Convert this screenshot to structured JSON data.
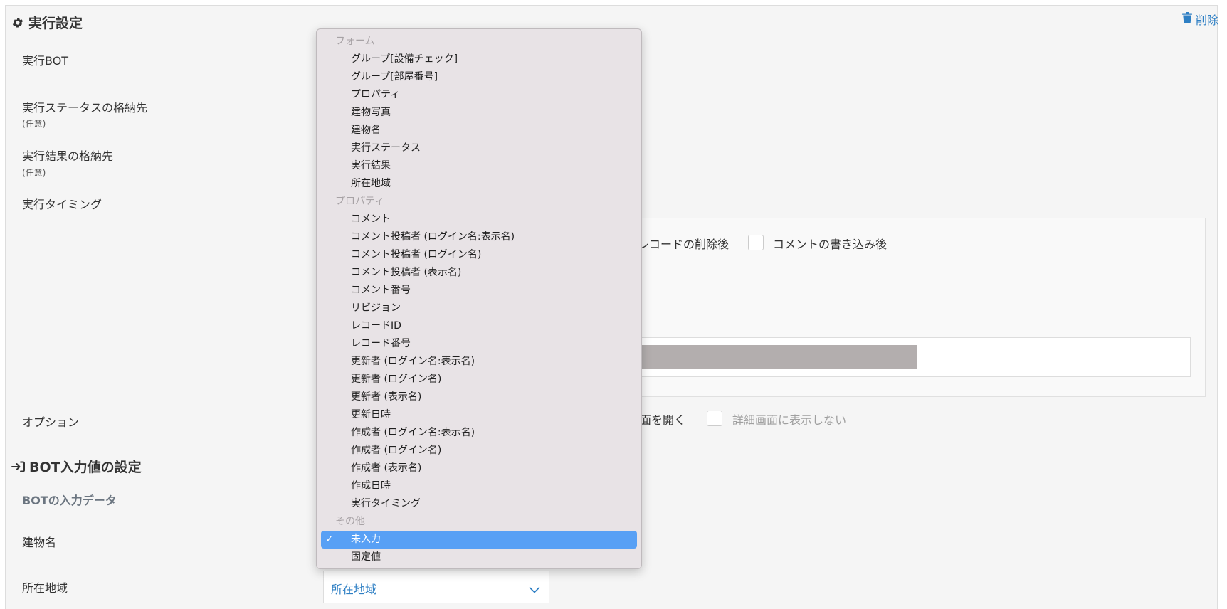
{
  "execution": {
    "title": "実行設定",
    "delete_label": "削除",
    "bot_label": "実行BOT",
    "status_dest_label": "実行ステータスの格納先",
    "status_dest_sub": "(任意)",
    "result_dest_label": "実行結果の格納先",
    "result_dest_sub": "(任意)",
    "timing_label": "実行タイミング",
    "timing_options": {
      "after_record_delete": "レコードの削除後",
      "after_comment_write": "コメントの書き込み後"
    },
    "options_label": "オプション",
    "option_open_screen": "画面を開く",
    "option_hide_detail": "詳細画面に表示しない"
  },
  "bot_input": {
    "title": "BOT入力値の設定",
    "input_data_label": "BOTの入力データ",
    "building_name_label": "建物名",
    "location_label": "所在地域",
    "location_select_value": "所在地域"
  },
  "dropdown": {
    "groups": [
      {
        "label": "フォーム",
        "items": [
          "グループ[設備チェック]",
          "グループ[部屋番号]",
          "プロパティ",
          "建物写真",
          "建物名",
          "実行ステータス",
          "実行結果",
          "所在地域"
        ]
      },
      {
        "label": "プロパティ",
        "items": [
          "コメント",
          "コメント投稿者 (ログイン名:表示名)",
          "コメント投稿者 (ログイン名)",
          "コメント投稿者 (表示名)",
          "コメント番号",
          "リビジョン",
          "レコードID",
          "レコード番号",
          "更新者 (ログイン名:表示名)",
          "更新者 (ログイン名)",
          "更新者 (表示名)",
          "更新日時",
          "作成者 (ログイン名:表示名)",
          "作成者 (ログイン名)",
          "作成者 (表示名)",
          "作成日時",
          "実行タイミング"
        ]
      },
      {
        "label": "その他",
        "items": [
          "未入力",
          "固定値"
        ]
      }
    ],
    "selected": "未入力",
    "check_mark": "✓"
  },
  "colors": {
    "accent": "#2e7fc4",
    "selection": "#58a0f5",
    "menu_bg": "#e8e3e6"
  }
}
